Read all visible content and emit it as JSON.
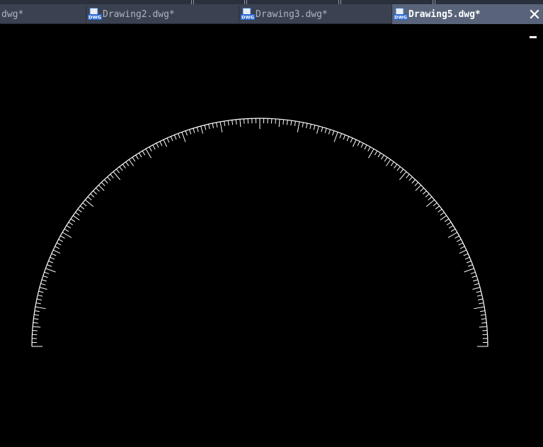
{
  "window": {
    "tabs": [
      {
        "label": "dwg*",
        "active": false,
        "icon": null
      },
      {
        "label": "Drawing2.dwg*",
        "active": false,
        "icon": "dwg-file-icon"
      },
      {
        "label": "Drawing3.dwg*",
        "active": false,
        "icon": "dwg-file-icon"
      },
      {
        "label": "Drawing5.dwg*",
        "active": true,
        "icon": "dwg-file-icon"
      }
    ],
    "close_icon": "close-icon",
    "minimize_icon": "minimize-icon"
  },
  "icon_badge_text": "DWG",
  "colors": {
    "canvas_background": "#000000",
    "tabbar_background": "#3a4150",
    "active_tab": "#59647a",
    "inactive_tab_text": "#aeb4c0",
    "drawing_line": "#ffffff"
  },
  "drawing": {
    "object": "protractor-semicircle",
    "arc_degrees": 180,
    "tick_step_degrees": 1,
    "medium_tick_every_degrees": 5,
    "major_tick_every_degrees": 10
  }
}
